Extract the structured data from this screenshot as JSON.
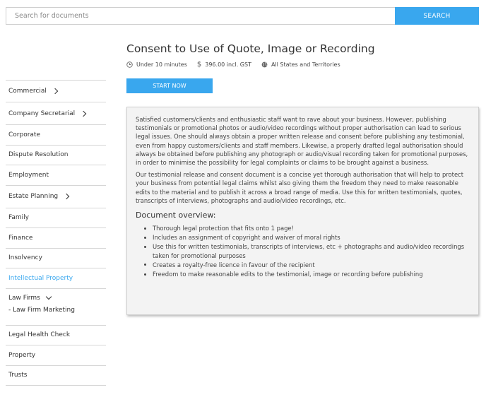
{
  "search": {
    "placeholder": "Search for documents",
    "button_label": "SEARCH"
  },
  "sidebar": {
    "items": [
      {
        "label": "Commercial",
        "chevron": true
      },
      {
        "label": "Company Secretarial",
        "chevron": true
      },
      {
        "label": "Corporate"
      },
      {
        "label": "Dispute Resolution"
      },
      {
        "label": "Employment"
      },
      {
        "label": "Estate Planning",
        "chevron": true
      },
      {
        "label": "Family"
      },
      {
        "label": "Finance"
      },
      {
        "label": "Insolvency"
      },
      {
        "label": "Intellectual Property",
        "active": true
      }
    ],
    "group": {
      "label": "Law Firms",
      "sub_items": [
        "- Law Firm Marketing"
      ]
    },
    "items_after": [
      {
        "label": "Legal Health Check"
      },
      {
        "label": "Property"
      },
      {
        "label": "Trusts"
      }
    ]
  },
  "document": {
    "title": "Consent to Use of Quote, Image or Recording",
    "time": "Under 10 minutes",
    "price": "396.00 incl. GST",
    "region": "All States and Territories",
    "start_label": "START NOW",
    "paragraphs": [
      "Satisfied customers/clients and enthusiastic staff want to rave about your business. However, publishing testimonials or promotional photos or audio/video recordings without proper authorisation can lead to serious legal issues. One should always obtain a proper written release and consent before publishing any testimonial, even from happy customers/clients and staff members. Likewise, a properly drafted legal authorisation should always be obtained before publishing any photograph or audio/visual recording taken for promotional purposes, in order to minimise the possibility for legal complaints or claims to be brought against a business.",
      "Our testimonial release and consent document is a concise yet thorough authorisation that will help to protect your business from potential legal claims whilst also giving them the freedom they need to make reasonable edits to the material and to publish it across a broad range of media. Use this for written testimonials, quotes, transcripts of interviews, photographs and audio/video recordings, etc."
    ],
    "overview_heading": "Document overview:",
    "overview_items": [
      "Thorough legal protection that fits onto 1 page!",
      "Includes an assignment of copyright and waiver of moral rights",
      "Use this for written testimonials, transcripts of interviews, etc + photographs and audio/video recordings taken for promotional purposes",
      "Creates a royalty-free licence in favour of the recipient",
      "Freedom to make reasonable edits to the testimonial, image or recording before publishing"
    ]
  },
  "colors": {
    "accent": "#39a7ee",
    "panel_bg": "#f3f3f3"
  }
}
